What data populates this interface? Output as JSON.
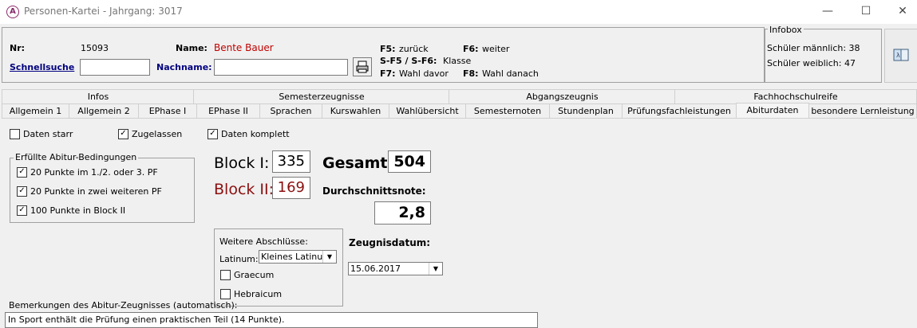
{
  "window": {
    "title": "Personen-Kartei - Jahrgang: 3017",
    "minimize": "—",
    "maximize": "☐",
    "close": "✕"
  },
  "header": {
    "nr_label": "Nr:",
    "nr_value": "15093",
    "name_label": "Name:",
    "name_value": "Bente Bauer",
    "schnellsuche": "Schnellsuche",
    "nachname_label": "Nachname:",
    "schnellsuche_value": "",
    "nachname_value": "",
    "shortcuts": {
      "f5_key": "F5:",
      "f5_text": "zurück",
      "f6_key": "F6:",
      "f6_text": "weiter",
      "sf5_key": "S-F5 / S-F6:",
      "sf5_text": "Klasse",
      "f7_key": "F7:",
      "f7_text": "Wahl davor",
      "f8_key": "F8:",
      "f8_text": "Wahl danach"
    }
  },
  "infobox": {
    "title": "Infobox",
    "male": "Schüler männlich: 38",
    "female": "Schüler weiblich: 47"
  },
  "tabs_top": [
    "Infos",
    "Semesterzeugnisse",
    "Abgangszeugnis",
    "Fachhochschulreife"
  ],
  "tabs_bottom": [
    "Allgemein 1",
    "Allgemein 2",
    "EPhase I",
    "EPhase II",
    "Sprachen",
    "Kurswahlen",
    "Wahlübersicht",
    "Semesternoten",
    "Stundenplan",
    "Prüfungsfachleistungen",
    "Abiturdaten",
    "besondere Lernleistung"
  ],
  "selected_tab": "Abiturdaten",
  "checks": {
    "daten_starr": "Daten starr",
    "zugelassen": "Zugelassen",
    "daten_komplett": "Daten komplett"
  },
  "bedingungen": {
    "title": "Erfüllte Abitur-Bedingungen",
    "items": [
      "20 Punkte im 1./2. oder 3. PF",
      "20 Punkte in zwei weiteren PF",
      "100 Punkte in Block II"
    ]
  },
  "scores": {
    "block1_label": "Block I:",
    "block1_value": "335",
    "block2_label": "Block II:",
    "block2_value": "169",
    "gesamt_label": "Gesamt:",
    "gesamt_value": "504",
    "durchschnitt_label": "Durchschnittsnote:",
    "durchschnitt_value": "2,8"
  },
  "weitere": {
    "title": "Weitere Abschlüsse:",
    "latinum_label": "Latinum:",
    "latinum_value": "Kleines Latinum",
    "graecum": "Graecum",
    "hebraicum": "Hebraicum"
  },
  "zeugnis": {
    "label": "Zeugnisdatum:",
    "value": "15.06.2017"
  },
  "bemerkungen": {
    "label": "Bemerkungen des Abitur-Zeugnisses (automatisch):",
    "text": "In Sport enthält die Prüfung einen praktischen Teil (14 Punkte)."
  },
  "colors": {
    "name_red": "#c00000",
    "block2_red": "#8b1010",
    "link_blue": "#000080"
  }
}
